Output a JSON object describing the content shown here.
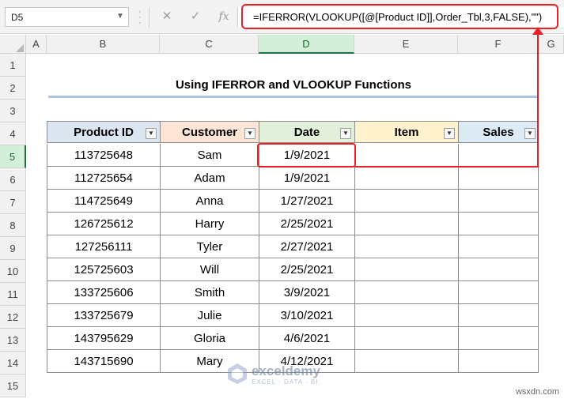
{
  "formula_bar": {
    "name_box": "D5",
    "cancel_icon": "✕",
    "enter_icon": "✓",
    "fx_label": "fx",
    "formula": "=IFERROR(VLOOKUP([@[Product ID]],Order_Tbl,3,FALSE),\"\")"
  },
  "columns": [
    "A",
    "B",
    "C",
    "D",
    "E",
    "F",
    "G"
  ],
  "selected_column": "D",
  "rows": [
    "1",
    "2",
    "3",
    "4",
    "5",
    "6",
    "7",
    "8",
    "9",
    "10",
    "11",
    "12",
    "13",
    "14",
    "15"
  ],
  "selected_row": "5",
  "sheet": {
    "title": "Using IFERROR and VLOOKUP Functions",
    "table": {
      "headers": [
        "Product ID",
        "Customer",
        "Date",
        "Item",
        "Sales"
      ],
      "header_colors": [
        "#dce6f1",
        "#fce4d6",
        "#e2efda",
        "#fff2cc",
        "#ddebf7"
      ],
      "rows": [
        [
          "113725648",
          "Sam",
          "1/9/2021",
          "",
          ""
        ],
        [
          "112725654",
          "Adam",
          "1/9/2021",
          "",
          ""
        ],
        [
          "114725649",
          "Anna",
          "1/27/2021",
          "",
          ""
        ],
        [
          "126725612",
          "Harry",
          "2/25/2021",
          "",
          ""
        ],
        [
          "127256111",
          "Tyler",
          "2/27/2021",
          "",
          ""
        ],
        [
          "125725603",
          "Will",
          "2/25/2021",
          "",
          ""
        ],
        [
          "133725606",
          "Smith",
          "3/9/2021",
          "",
          ""
        ],
        [
          "133725679",
          "Julie",
          "3/10/2021",
          "",
          ""
        ],
        [
          "143795629",
          "Gloria",
          "4/6/2021",
          "",
          ""
        ],
        [
          "143715690",
          "Mary",
          "4/12/2021",
          "",
          ""
        ]
      ]
    }
  },
  "watermark": {
    "name": "exceldemy",
    "tagline": "EXCEL · DATA · BI"
  },
  "credit": "wsxdn.com",
  "colors": {
    "annotation_red": "#e8202a",
    "selected_green": "#217346"
  }
}
